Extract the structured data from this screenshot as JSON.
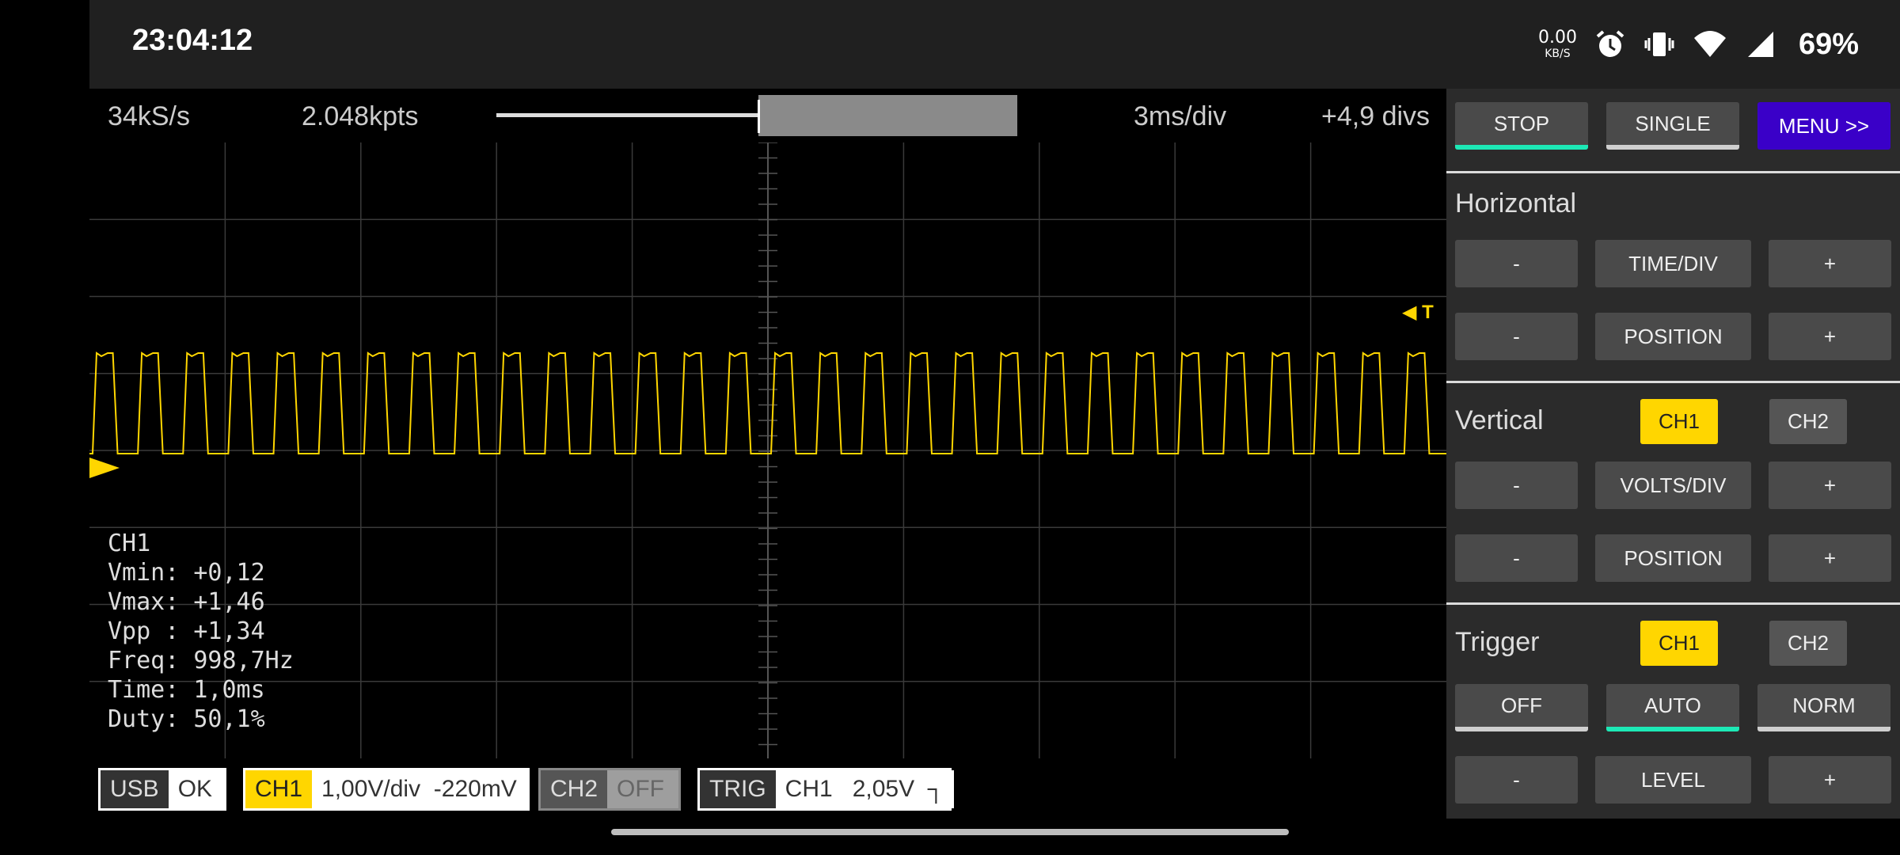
{
  "status_bar": {
    "time": "23:04:12",
    "net_speed_value": "0.00",
    "net_speed_unit": "KB/S",
    "battery": "69%",
    "icons": [
      "alarm-icon",
      "vibrate-icon",
      "wifi-icon",
      "signal-icon"
    ]
  },
  "info_bar": {
    "sample_rate": "34kS/s",
    "points": "2.048kpts",
    "timebase": "3ms/div",
    "position": "+4,9 divs",
    "buffer_window_fraction": [
      0.5,
      1.0
    ]
  },
  "measurements": {
    "channel": "CH1",
    "lines": [
      "Vmin: +0,12",
      "Vmax: +1,46",
      "Vpp : +1,34",
      "Freq: 998,7Hz",
      "Time: 1,0ms",
      "Duty: 50,1%"
    ]
  },
  "bottom_bar": {
    "usb_label": "USB",
    "usb_value": "OK",
    "ch1_label": "CH1",
    "ch1_value": "1,00V/div  -220mV",
    "ch2_label": "CH2",
    "ch2_value": "OFF",
    "trig_label": "TRIG",
    "trig_value": "CH1   2,05V  ┐"
  },
  "panel": {
    "stop": "STOP",
    "single": "SINGLE",
    "menu": "MENU >>",
    "horizontal_title": "Horizontal",
    "minus": "-",
    "plus": "+",
    "time_div": "TIME/DIV",
    "position": "POSITION",
    "vertical_title": "Vertical",
    "ch1": "CH1",
    "ch2": "CH2",
    "volts_div": "VOLTS/DIV",
    "trigger_title": "Trigger",
    "off": "OFF",
    "auto": "AUTO",
    "norm": "NORM",
    "level": "LEVEL"
  },
  "colors": {
    "trace": "#ffd600",
    "accent_green": "#1de9b6",
    "menu_blue": "#3a00c8",
    "grid": "#3a3a3a"
  },
  "trigger_marker": "T"
}
